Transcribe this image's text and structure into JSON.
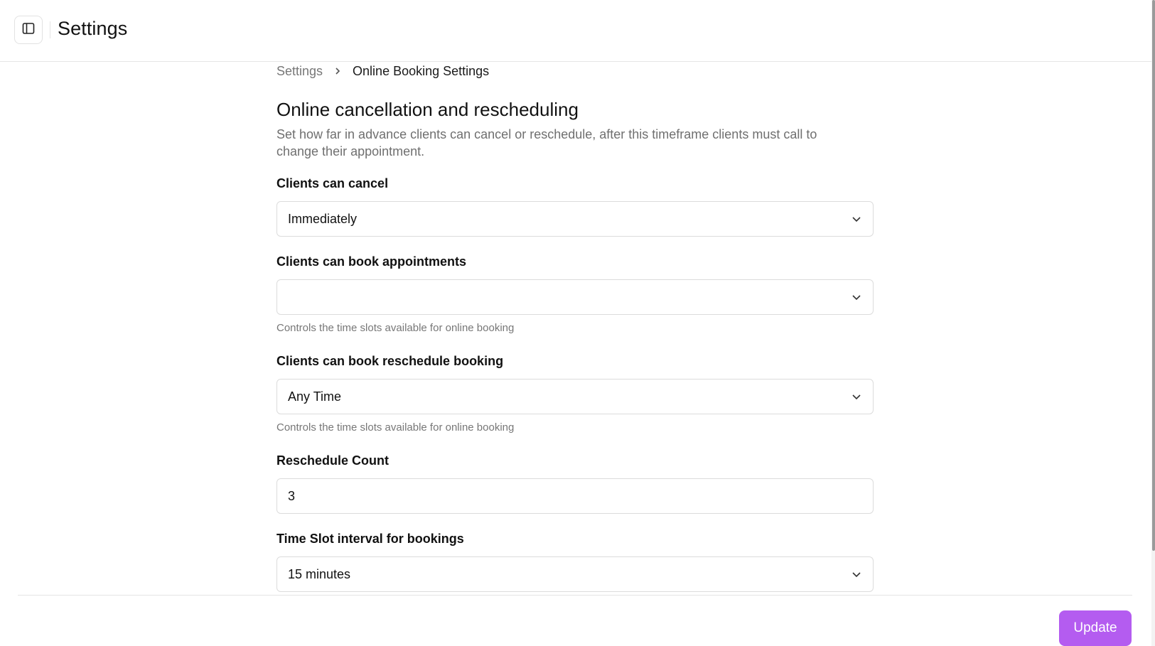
{
  "header": {
    "title": "Settings",
    "toggle_icon": "sidebar-panel-icon"
  },
  "breadcrumb": {
    "root": "Settings",
    "current": "Online Booking Settings"
  },
  "section": {
    "title": "Online cancellation and rescheduling",
    "description": "Set how far in advance clients can cancel or reschedule, after this timeframe clients must call to change their appointment."
  },
  "fields": {
    "cancel": {
      "label": "Clients can cancel",
      "value": "Immediately"
    },
    "book": {
      "label": "Clients can book appointments",
      "value": "",
      "helper": "Controls the time slots available for online booking"
    },
    "reschedule": {
      "label": "Clients can book reschedule booking",
      "value": "Any Time",
      "helper": "Controls the time slots available for online booking"
    },
    "reschedule_count": {
      "label": "Reschedule Count",
      "value": "3"
    },
    "interval": {
      "label": "Time Slot interval for bookings",
      "value": "15 minutes"
    }
  },
  "footer": {
    "update_label": "Update"
  },
  "colors": {
    "accent": "#b45cf0",
    "muted_text": "#777777",
    "border": "#dcdcdc"
  }
}
